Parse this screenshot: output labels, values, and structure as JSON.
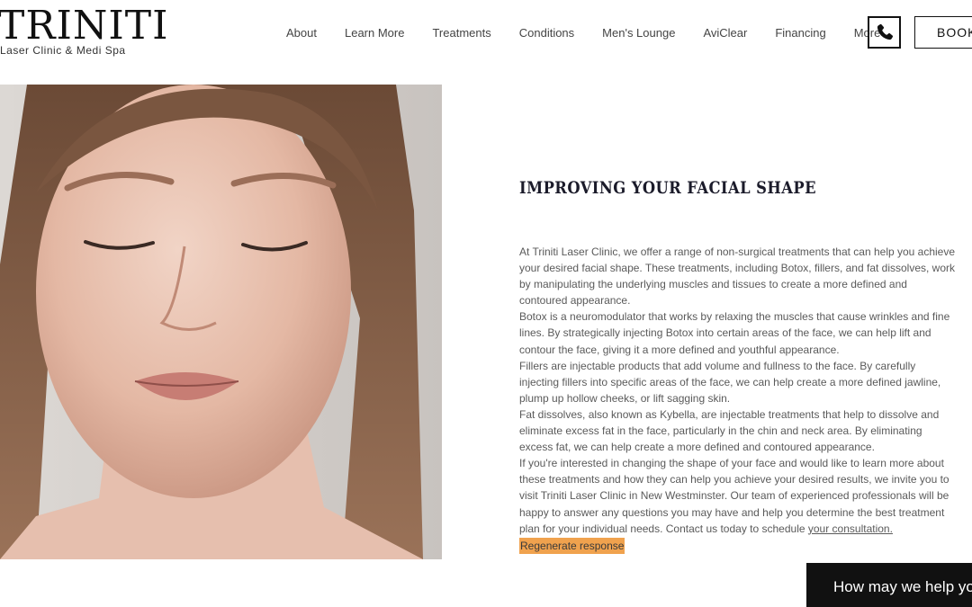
{
  "brand": {
    "name": "TRINITI",
    "tagline": "Laser Clinic & Medi Spa"
  },
  "nav": {
    "items": [
      {
        "label": "About"
      },
      {
        "label": "Learn More"
      },
      {
        "label": "Treatments"
      },
      {
        "label": "Conditions"
      },
      {
        "label": "Men's Lounge"
      },
      {
        "label": "AviClear"
      },
      {
        "label": "Financing"
      },
      {
        "label": "More"
      }
    ],
    "phone_icon": "phone-icon",
    "book_label": "BOOK"
  },
  "hero": {
    "image_icon": "portrait-photo"
  },
  "content": {
    "heading": "IMPROVING YOUR FACIAL SHAPE",
    "paragraphs": [
      "At Triniti Laser Clinic, we offer a range of non-surgical treatments that can help you achieve your desired facial shape. These treatments, including Botox, fillers, and fat dissolves, work by manipulating the underlying muscles and tissues to create a more defined and contoured appearance.",
      "Botox is a neuromodulator that works by relaxing the muscles that cause wrinkles and fine lines. By strategically injecting Botox into certain areas of the face, we can help lift and contour the face, giving it a more defined and youthful appearance.",
      "Fillers are injectable products that add volume and fullness to the face. By carefully injecting fillers into specific areas of the face, we can help create a more defined jawline, plump up hollow cheeks, or lift sagging skin.",
      "Fat dissolves, also known as Kybella, are injectable treatments that help to dissolve and eliminate excess fat in the face, particularly in the chin and neck area. By eliminating excess fat, we can help create a more defined and contoured appearance.",
      "If you're interested in changing the shape of your face and would like to learn more about these treatments and how they can help you achieve your desired results, we invite you to visit Triniti Laser Clinic in New Westminster. Our team of experienced professionals will be happy to answer any questions you may have and help you determine the best treatment plan for your individual needs. Contact us today to schedule "
    ],
    "consultation_link": "your consultation.",
    "regenerate_label": "Regenerate response"
  },
  "chat": {
    "label": "How may we help you?",
    "icon": "chat-bubble-icon"
  },
  "colors": {
    "highlight": "#f0a24e",
    "heading": "#1b1b2a",
    "chat_bg": "#111111"
  }
}
